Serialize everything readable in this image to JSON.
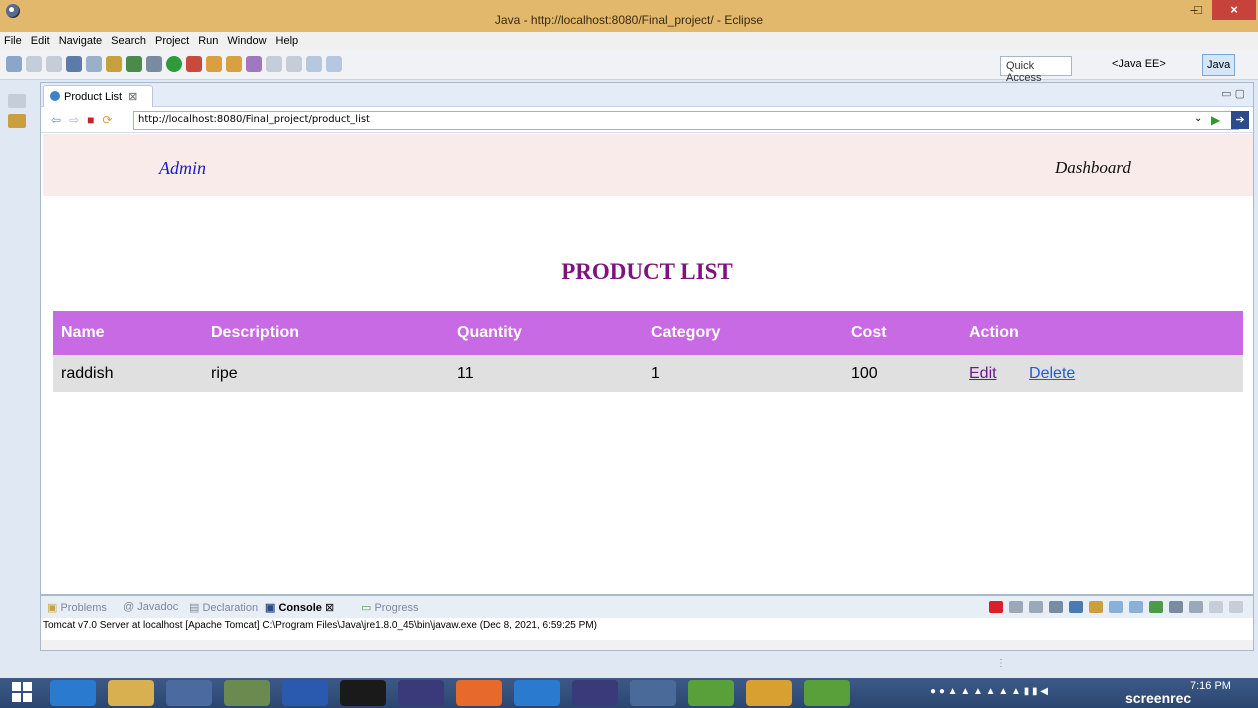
{
  "window": {
    "title": "Java - http://localhost:8080/Final_project/ - Eclipse",
    "min": "–",
    "max": "□",
    "close": "×"
  },
  "menu": [
    "File",
    "Edit",
    "Navigate",
    "Search",
    "Project",
    "Run",
    "Window",
    "Help"
  ],
  "toolbar": {
    "quick_access": "Quick Access",
    "perspective_ee": "<Java EE>",
    "perspective_java": "Java"
  },
  "editor": {
    "tab_label": "Product List",
    "tab_close": "⊠",
    "url": "http://localhost:8080/Final_project/product_list"
  },
  "page": {
    "brand": "Admin",
    "dashboard": "Dashboard",
    "title": "PRODUCT LIST",
    "columns": [
      "Name",
      "Description",
      "Quantity",
      "Category",
      "Cost",
      "Action"
    ],
    "rows": [
      {
        "name": "raddish",
        "description": "ripe",
        "quantity": "11",
        "category": "1",
        "cost": "100",
        "edit": "Edit",
        "delete": "Delete"
      }
    ]
  },
  "console": {
    "tabs": [
      "Problems",
      "Javadoc",
      "Declaration",
      "Console",
      "Progress"
    ],
    "text": "Tomcat v7.0 Server at localhost [Apache Tomcat] C:\\Program Files\\Java\\jre1.8.0_45\\bin\\javaw.exe (Dec 8, 2021, 6:59:25 PM)"
  },
  "taskbar": {
    "time": "7:16 PM",
    "watermark": "screenrec"
  },
  "colors": {
    "titlebar": "#e2b86c",
    "table_header": "#c76ae3",
    "page_title": "#7d137d",
    "header_band": "#f8ebea"
  }
}
